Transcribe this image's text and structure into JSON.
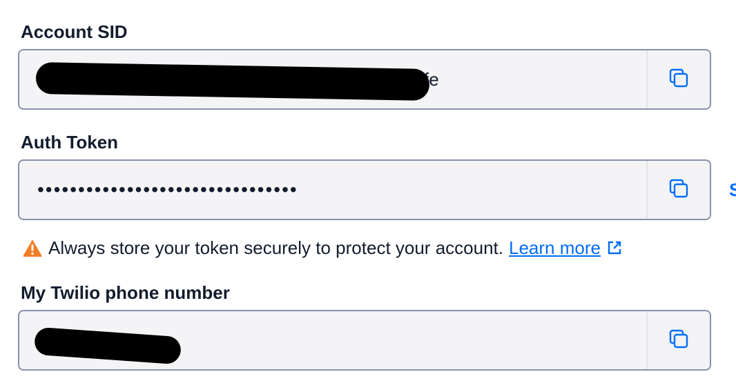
{
  "account_sid": {
    "label": "Account SID",
    "visible_suffix": "fe",
    "copy_icon": "copy-icon"
  },
  "auth_token": {
    "label": "Auth Token",
    "masked_value": "••••••••••••••••••••••••••••••••",
    "copy_icon": "copy-icon",
    "side_action_label": "S"
  },
  "warning": {
    "icon": "warning-icon",
    "text": "Always store your token securely to protect your account.",
    "link_label": "Learn more",
    "link_icon": "external-link-icon"
  },
  "phone": {
    "label": "My Twilio phone number",
    "copy_icon": "copy-icon"
  },
  "colors": {
    "link": "#006dfa",
    "warning": "#f47c22",
    "field_bg": "#f4f4f6",
    "field_border": "#8891aa"
  }
}
